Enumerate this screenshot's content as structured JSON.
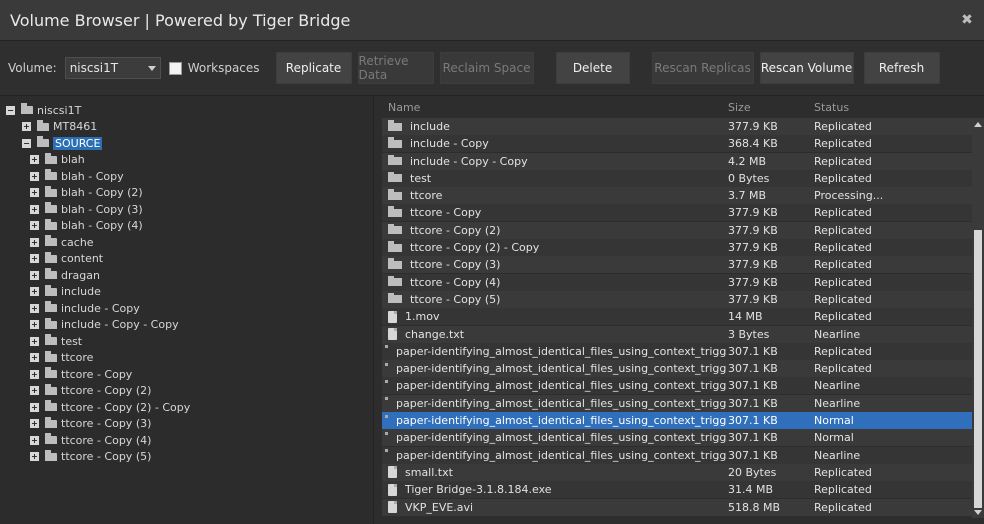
{
  "window": {
    "title": "Volume Browser | Powered by Tiger Bridge",
    "close_glyph": "✖"
  },
  "toolbar": {
    "volume_label": "Volume:",
    "volume_value": "niscsi1T",
    "workspaces_label": "Workspaces",
    "buttons": [
      {
        "label": "Replicate",
        "enabled": true
      },
      {
        "label": "Retrieve Data",
        "enabled": false
      },
      {
        "label": "Reclaim Space",
        "enabled": false
      },
      {
        "label": "Delete",
        "enabled": true
      },
      {
        "label": "Rescan Replicas",
        "enabled": false
      },
      {
        "label": "Rescan Volume",
        "enabled": true
      },
      {
        "label": "Refresh",
        "enabled": true
      }
    ]
  },
  "tree": {
    "root": "niscsi1T",
    "items": [
      {
        "label": "MT8461",
        "level": 1
      },
      {
        "label": "SOURCE",
        "level": 1,
        "selected": true
      },
      {
        "label": "blah",
        "level": 2
      },
      {
        "label": "blah - Copy",
        "level": 2
      },
      {
        "label": "blah - Copy (2)",
        "level": 2
      },
      {
        "label": "blah - Copy (3)",
        "level": 2
      },
      {
        "label": "blah - Copy (4)",
        "level": 2
      },
      {
        "label": "cache",
        "level": 2
      },
      {
        "label": "content",
        "level": 2
      },
      {
        "label": "dragan",
        "level": 2
      },
      {
        "label": "include",
        "level": 2
      },
      {
        "label": "include - Copy",
        "level": 2
      },
      {
        "label": "include - Copy - Copy",
        "level": 2
      },
      {
        "label": "test",
        "level": 2
      },
      {
        "label": "ttcore",
        "level": 2
      },
      {
        "label": "ttcore - Copy",
        "level": 2
      },
      {
        "label": "ttcore - Copy (2)",
        "level": 2
      },
      {
        "label": "ttcore - Copy (2) - Copy",
        "level": 2
      },
      {
        "label": "ttcore - Copy (3)",
        "level": 2
      },
      {
        "label": "ttcore - Copy (4)",
        "level": 2
      },
      {
        "label": "ttcore - Copy (5)",
        "level": 2
      }
    ]
  },
  "list": {
    "headers": {
      "name": "Name",
      "size": "Size",
      "status": "Status"
    },
    "rows": [
      {
        "name": "include",
        "size": "377.9 KB",
        "status": "Replicated",
        "type": "folder"
      },
      {
        "name": "include - Copy",
        "size": "368.4 KB",
        "status": "Replicated",
        "type": "folder"
      },
      {
        "name": "include - Copy - Copy",
        "size": "4.2 MB",
        "status": "Replicated",
        "type": "folder"
      },
      {
        "name": "test",
        "size": "0 Bytes",
        "status": "Replicated",
        "type": "folder"
      },
      {
        "name": "ttcore",
        "size": "3.7 MB",
        "status": "Processing...",
        "type": "folder"
      },
      {
        "name": "ttcore - Copy",
        "size": "377.9 KB",
        "status": "Replicated",
        "type": "folder"
      },
      {
        "name": "ttcore - Copy (2)",
        "size": "377.9 KB",
        "status": "Replicated",
        "type": "folder"
      },
      {
        "name": "ttcore - Copy (2) - Copy",
        "size": "377.9 KB",
        "status": "Replicated",
        "type": "folder"
      },
      {
        "name": "ttcore - Copy (3)",
        "size": "377.9 KB",
        "status": "Replicated",
        "type": "folder"
      },
      {
        "name": "ttcore - Copy (4)",
        "size": "377.9 KB",
        "status": "Replicated",
        "type": "folder"
      },
      {
        "name": "ttcore - Copy (5)",
        "size": "377.9 KB",
        "status": "Replicated",
        "type": "folder"
      },
      {
        "name": "1.mov",
        "size": "14 MB",
        "status": "Replicated",
        "type": "file"
      },
      {
        "name": "change.txt",
        "size": "3 Bytes",
        "status": "Nearline",
        "type": "file"
      },
      {
        "name": "paper-identifying_almost_identical_files_using_context_trigg ...",
        "size": "307.1 KB",
        "status": "Replicated",
        "type": "file"
      },
      {
        "name": "paper-identifying_almost_identical_files_using_context_trigg ...",
        "size": "307.1 KB",
        "status": "Replicated",
        "type": "file"
      },
      {
        "name": "paper-identifying_almost_identical_files_using_context_trigg ...",
        "size": "307.1 KB",
        "status": "Nearline",
        "type": "file"
      },
      {
        "name": "paper-identifying_almost_identical_files_using_context_trigg ...",
        "size": "307.1 KB",
        "status": "Nearline",
        "type": "file"
      },
      {
        "name": "paper-identifying_almost_identical_files_using_context_trigg ...",
        "size": "307.1 KB",
        "status": "Normal",
        "type": "file",
        "selected": true
      },
      {
        "name": "paper-identifying_almost_identical_files_using_context_trigg ...",
        "size": "307.1 KB",
        "status": "Normal",
        "type": "file"
      },
      {
        "name": "paper-identifying_almost_identical_files_using_context_trigg ...",
        "size": "307.1 KB",
        "status": "Nearline",
        "type": "file"
      },
      {
        "name": "small.txt",
        "size": "20 Bytes",
        "status": "Replicated",
        "type": "file"
      },
      {
        "name": "Tiger Bridge-3.1.8.184.exe",
        "size": "31.4 MB",
        "status": "Replicated",
        "type": "file"
      },
      {
        "name": "VKP_EVE.avi",
        "size": "518.8 MB",
        "status": "Replicated",
        "type": "file"
      }
    ]
  },
  "colors": {
    "selection": "#2f6fbb",
    "tree_selection": "#2b6fb5"
  }
}
